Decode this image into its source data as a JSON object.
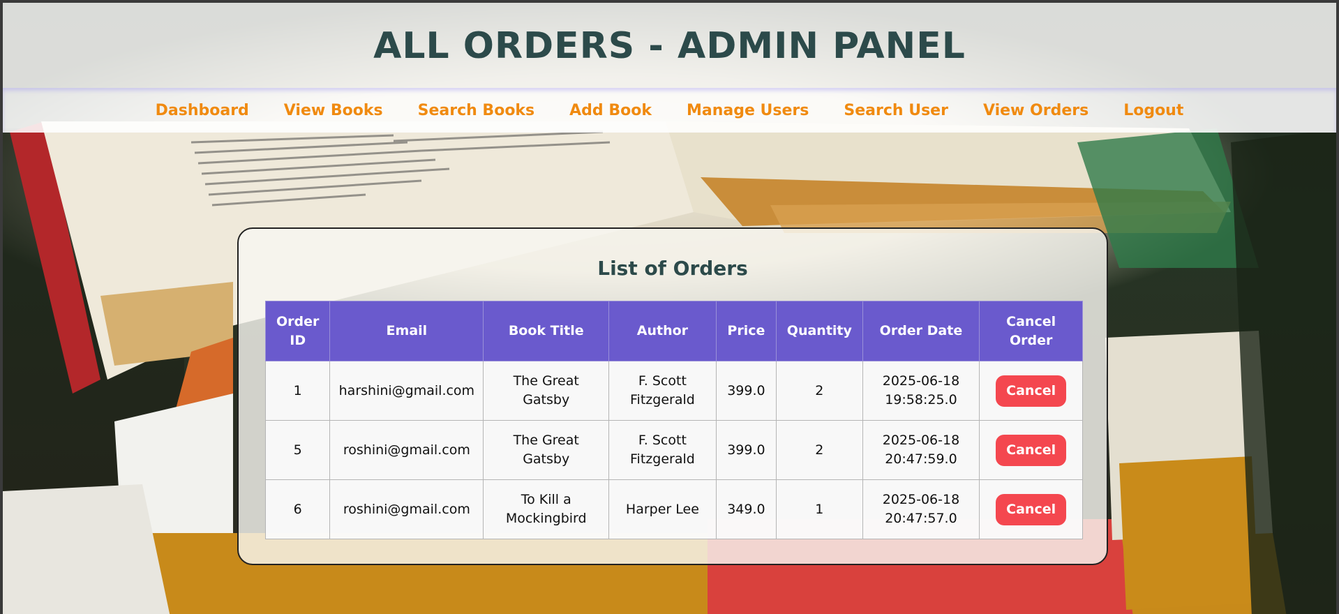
{
  "header": {
    "title": "ALL ORDERS - ADMIN PANEL"
  },
  "nav": {
    "items": [
      {
        "label": "Dashboard"
      },
      {
        "label": "View Books"
      },
      {
        "label": "Search Books"
      },
      {
        "label": "Add Book"
      },
      {
        "label": "Manage Users"
      },
      {
        "label": "Search User"
      },
      {
        "label": "View Orders"
      },
      {
        "label": "Logout"
      }
    ]
  },
  "orders": {
    "heading": "List of Orders",
    "columns": [
      "Order ID",
      "Email",
      "Book Title",
      "Author",
      "Price",
      "Quantity",
      "Order Date",
      "Cancel Order"
    ],
    "rows": [
      {
        "order_id": "1",
        "email": "harshini@gmail.com",
        "book_title": "The Great Gatsby",
        "author": "F. Scott Fitzgerald",
        "price": "399.0",
        "quantity": "2",
        "order_date": "2025-06-18 19:58:25.0",
        "action": "Cancel"
      },
      {
        "order_id": "5",
        "email": "roshini@gmail.com",
        "book_title": "The Great Gatsby",
        "author": "F. Scott Fitzgerald",
        "price": "399.0",
        "quantity": "2",
        "order_date": "2025-06-18 20:47:59.0",
        "action": "Cancel"
      },
      {
        "order_id": "6",
        "email": "roshini@gmail.com",
        "book_title": "To Kill a Mockingbird",
        "author": "Harper Lee",
        "price": "349.0",
        "quantity": "1",
        "order_date": "2025-06-18 20:47:57.0",
        "action": "Cancel"
      }
    ]
  },
  "colors": {
    "title": "#2c4a4a",
    "nav_link": "#f08a10",
    "table_header": "#6a5acd",
    "cancel_button": "#f4474f"
  }
}
